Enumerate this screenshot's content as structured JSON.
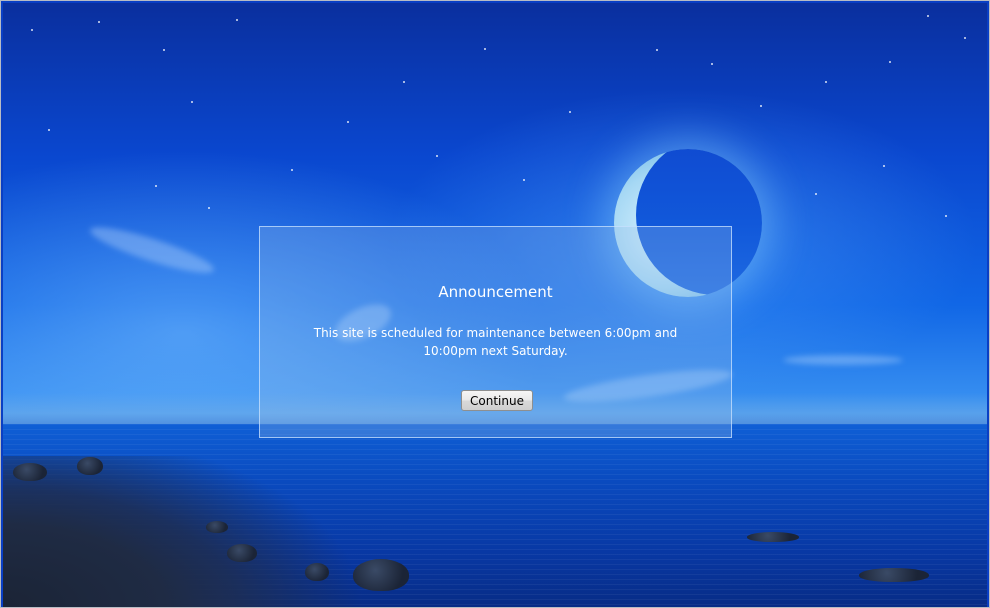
{
  "dialog": {
    "title": "Announcement",
    "message": "This site is scheduled for maintenance between 6:00pm and 10:00pm next Saturday.",
    "continue_label": "Continue"
  },
  "colors": {
    "sky_top": "#0a2f9e",
    "sky_mid": "#1167e6",
    "sea": "#0a4bc0",
    "moon": "#a6d8f4",
    "dialog_text": "#ffffff"
  }
}
